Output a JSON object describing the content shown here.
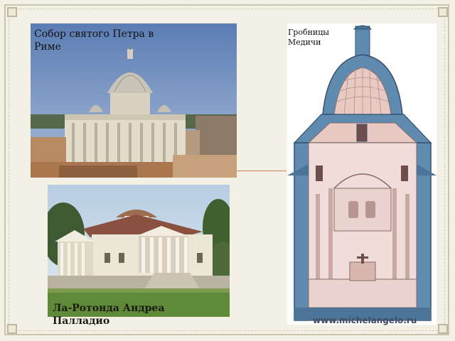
{
  "slide": {
    "caption_st_peter": "Собор святого Петра в Риме",
    "caption_medici": "Гробницы Медичи",
    "caption_rotonda": "Ла-Ротонда Андреа Палладио",
    "watermark": "www.michelangelo.ru"
  },
  "colors": {
    "background": "#f3f1e6",
    "frame": "#c9c5ae",
    "sky": "#6f8fc0",
    "medici_blue": "#5f8bb0",
    "medici_pink": "#e8c9c4"
  }
}
